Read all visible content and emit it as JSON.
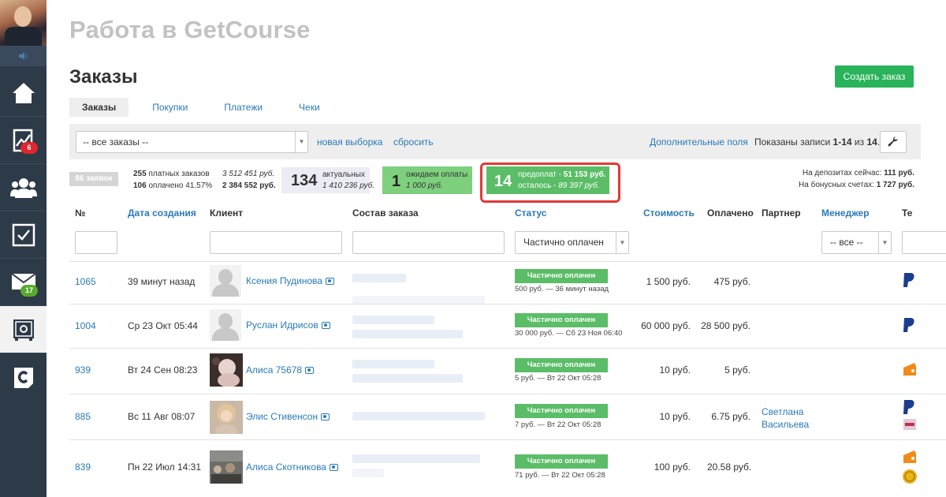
{
  "sidebar": {
    "items": [
      {
        "name": "home",
        "icon": "home-icon"
      },
      {
        "name": "analytics",
        "icon": "chart-icon",
        "badge": "6"
      },
      {
        "name": "users",
        "icon": "users-icon"
      },
      {
        "name": "tasks",
        "icon": "checkbox-icon"
      },
      {
        "name": "messages",
        "icon": "mail-icon",
        "badge": "17"
      },
      {
        "name": "sales",
        "icon": "safe-icon",
        "active": true
      },
      {
        "name": "getcourse",
        "icon": "getcourse-logo-icon"
      }
    ]
  },
  "header": {
    "school_title": "Работа в GetCourse",
    "page_title": "Заказы",
    "create_button": "Создать заказ"
  },
  "tabs": [
    "Заказы",
    "Покупки",
    "Платежи",
    "Чеки"
  ],
  "filterbar": {
    "selected_filter": "-- все заказы --",
    "new_selection": "новая выборка",
    "reset": "сбросить",
    "extra_fields": "Дополнительные поля",
    "shown_prefix": "Показаны записи",
    "shown_range": "1-14",
    "shown_of": "из",
    "shown_total": "14",
    "shown_dot": "."
  },
  "stats": {
    "orders_count": "86 заявок",
    "paid_count": "255",
    "paid_label": "платных заказов",
    "paid_sum": "3 512 451 руб.",
    "paid_done_count": "106",
    "paid_done_label": "оплачено 41.57%",
    "paid_done_sum": "2 384 552 руб.",
    "actual_count": "134",
    "actual_label": "актуальных",
    "actual_sum": "1 410 236 руб.",
    "waiting_count": "1",
    "waiting_label": "ожидаем оплаты",
    "waiting_sum": "1 000 руб.",
    "prepay_count": "14",
    "prepay_label": "предоплат -",
    "prepay_sum": "51 153 руб.",
    "prepay_left_label": "осталось -",
    "prepay_left_sum": "89 397 руб.",
    "deposit_label": "На депозитах сейчас:",
    "deposit_value": "111 руб.",
    "bonus_label": "На бонусных счетах:",
    "bonus_value": "1 727 руб."
  },
  "table": {
    "headers": {
      "num": "№",
      "created": "Дата создания",
      "client": "Клиент",
      "composition": "Состав заказа",
      "status": "Статус",
      "cost": "Стоимость",
      "paid": "Оплачено",
      "partner": "Партнер",
      "manager": "Менеджер",
      "extra": "Те"
    },
    "status_filter": "Частично оплачен",
    "manager_filter": "-- все --",
    "rows": [
      {
        "num": "1065",
        "date": "39 минут назад",
        "client": "Ксения Пудинова",
        "status": "Частично оплачен",
        "status_detail": "500 руб. — 36 минут назад",
        "cost": "1 500 руб.",
        "paid": "475 руб.",
        "partner": "",
        "avatar": "placeholder"
      },
      {
        "num": "1004",
        "date": "Ср 23 Окт 05:44",
        "client": "Руслан Идрисов",
        "status": "Частично оплачен",
        "status_detail": "30 000 руб. — Сб 23 Ноя 06:40",
        "cost": "60 000 руб.",
        "paid": "28 500 руб.",
        "partner": "",
        "avatar": "placeholder"
      },
      {
        "num": "939",
        "date": "Вт 24 Сен 08:23",
        "client": "Алиса 75678",
        "status": "Частично оплачен",
        "status_detail": "5 руб. — Вт 22 Окт 05:28",
        "cost": "10 руб.",
        "paid": "5 руб.",
        "partner": "",
        "avatar": "photo-1"
      },
      {
        "num": "885",
        "date": "Вс 11 Авг 08:07",
        "client": "Элис Стивенсон",
        "status": "Частично оплачен",
        "status_detail": "7 руб. — Вт 22 Окт 05:28",
        "cost": "10 руб.",
        "paid": "6.75 руб.",
        "partner": "Светлана Васильева",
        "avatar": "photo-2"
      },
      {
        "num": "839",
        "date": "Пн 22 Июл 14:31",
        "client": "Алиса Скотникова",
        "status": "Частично оплачен",
        "status_detail": "71 руб. — Вт 22 Окт 05:28",
        "cost": "100 руб.",
        "paid": "20.58 руб.",
        "partner": "",
        "avatar": "photo-3"
      }
    ]
  },
  "colors": {
    "sidebar_bg": "#2d3a48",
    "accent_link": "#2a7ab8",
    "status_green": "#5bbd67",
    "create_button": "#29b35a",
    "highlight_red": "#e03a36"
  }
}
